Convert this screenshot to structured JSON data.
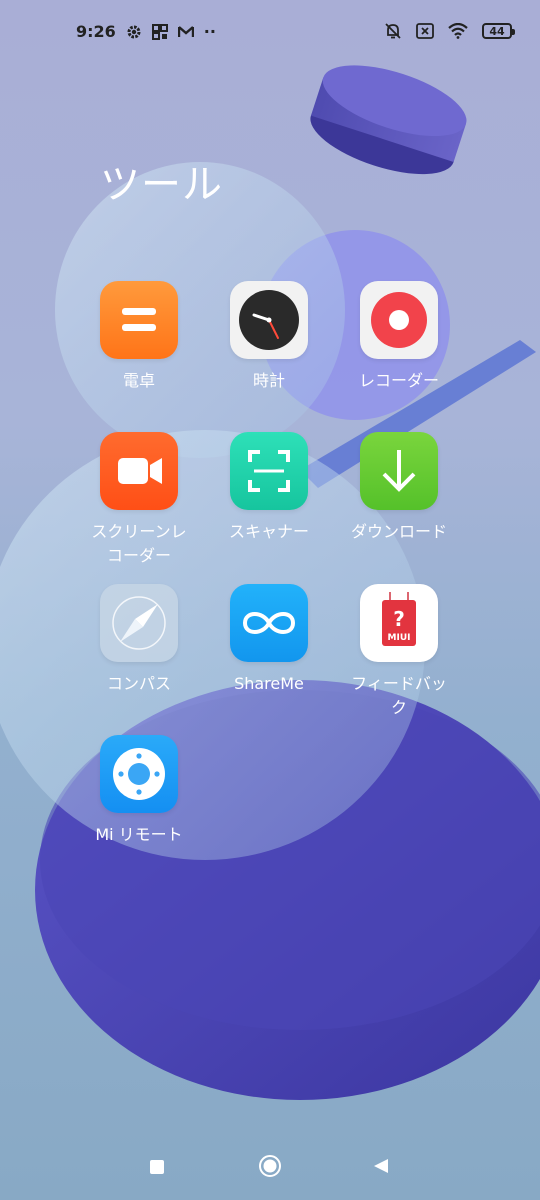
{
  "status_bar": {
    "time": "9:26",
    "left_icons": [
      "gear-icon",
      "grid-icon",
      "mail-icon",
      "more-dots-icon"
    ],
    "right_icons": [
      "bell-off-icon",
      "sim-off-icon",
      "wifi-icon"
    ],
    "battery": "44"
  },
  "folder": {
    "title": "ツール",
    "apps": [
      {
        "label": "電卓",
        "icon": "calculator-icon",
        "color": "#ff7f2a"
      },
      {
        "label": "時計",
        "icon": "clock-icon",
        "color": "#f4f4f4"
      },
      {
        "label": "レコーダー",
        "icon": "recorder-icon",
        "color": "#f4f4f4"
      },
      {
        "label": "スクリーンレコーダー",
        "icon": "screen-recorder-icon",
        "color": "#ff5a1e"
      },
      {
        "label": "スキャナー",
        "icon": "scanner-icon",
        "color": "#1fd1a8"
      },
      {
        "label": "ダウンロード",
        "icon": "download-icon",
        "color": "#62cc2e"
      },
      {
        "label": "コンパス",
        "icon": "compass-icon",
        "color": "#bccfe0"
      },
      {
        "label": "ShareMe",
        "icon": "shareme-icon",
        "color": "#1aa8f5"
      },
      {
        "label": "フィードバック",
        "icon": "feedback-icon",
        "color": "#ffffff"
      },
      {
        "label": "Mi リモート",
        "icon": "mi-remote-icon",
        "color": "#1c9bf6"
      }
    ]
  },
  "feedback_badge": "MIUI",
  "nav_bar": {
    "buttons": [
      "recents-button",
      "home-button",
      "back-button"
    ]
  }
}
